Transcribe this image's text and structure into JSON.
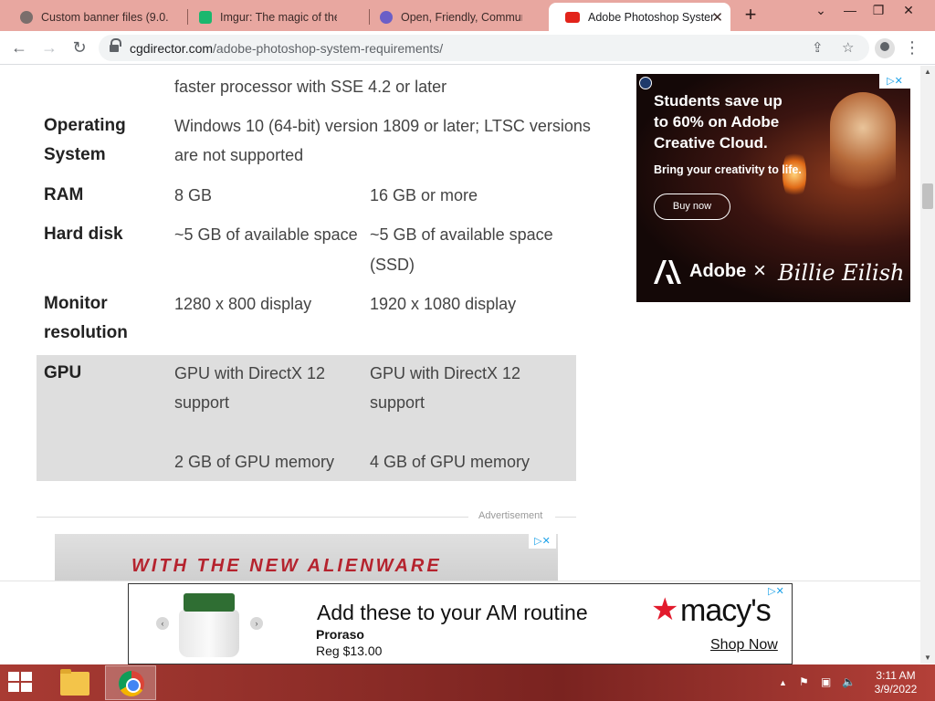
{
  "browser": {
    "tabs": [
      {
        "title": "Custom banner files (9.0...",
        "favicon_color": "#7a6e6c",
        "active": false
      },
      {
        "title": "Imgur: The magic of the Internet",
        "favicon_color": "#1bb76e",
        "active": false
      },
      {
        "title": "Open, Friendly, Community",
        "favicon_color": "#6b5fc7",
        "active": false
      },
      {
        "title": "Adobe Photoshop System Requirements",
        "favicon_color": "#e2231a",
        "active": true
      }
    ],
    "url_domain": "cgdirector.com",
    "url_path": "/adobe-photoshop-system-requirements/"
  },
  "specs": {
    "processor_tail": "faster processor with SSE 4.2 or later",
    "rows": [
      {
        "label_line1": "Operating",
        "label_line2": "System",
        "min_line1": "Windows 10 (64-bit) version 1809 or later; LTSC versions",
        "min_line2": "are not supported",
        "rec_line1": "",
        "rec_line2": ""
      },
      {
        "label_line1": "RAM",
        "label_line2": "",
        "min_line1": "8 GB",
        "min_line2": "",
        "rec_line1": "16 GB or more",
        "rec_line2": ""
      },
      {
        "label_line1": "Hard disk",
        "label_line2": "",
        "min_line1": "~5 GB of available space",
        "min_line2": "",
        "rec_line1": "~5 GB of available space",
        "rec_line2": "(SSD)"
      },
      {
        "label_line1": "Monitor",
        "label_line2": "resolution",
        "min_line1": "1280 x 800 display",
        "min_line2": "",
        "rec_line1": "1920 x 1080 display",
        "rec_line2": ""
      }
    ],
    "gpu": {
      "label": "GPU",
      "min_line1": "GPU with DirectX 12",
      "min_line2": "support",
      "min_line3": "2 GB of GPU memory",
      "rec_line1": "GPU with DirectX 12",
      "rec_line2": "support",
      "rec_line3": "4 GB of GPU memory"
    }
  },
  "advertisement_label": "Advertisement",
  "alienware_ad": {
    "text": "WITH THE NEW ALIENWARE"
  },
  "adobe_ad": {
    "headline_line1": "Students save up",
    "headline_line2": "to 60% on Adobe",
    "headline_line3": "Creative Cloud.",
    "subtext": "Bring your creativity to life.",
    "button": "Buy now",
    "brand": "Adobe",
    "times": "×",
    "partner": "Billie Eilish"
  },
  "macys_ad": {
    "headline": "Add these to your AM routine",
    "product": "Proraso",
    "price": "Reg  $13.00",
    "logo": "macy's",
    "cta": "Shop Now"
  },
  "taskbar": {
    "time": "3:11 AM",
    "date": "3/9/2022"
  }
}
